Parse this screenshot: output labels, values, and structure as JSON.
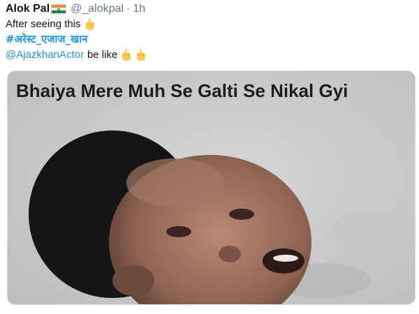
{
  "tweet": {
    "author_name": "Alok Pal",
    "handle": "@_alokpal",
    "separator": "·",
    "time": "1h",
    "line1_text": "After seeing this",
    "hashtag": "#अरेस्ट_एजाज_खान",
    "mention": "@AjazkhanActor",
    "line3_text": "be like",
    "media": {
      "caption": "Bhaiya Mere Muh Se Galti Se Nikal Gyi"
    }
  },
  "icons": {
    "flag": "india-flag-icon",
    "pointing_down": "pointing-down-hand-icon"
  },
  "colors": {
    "link": "#1b95e0",
    "secondary_text": "#657786",
    "primary_text": "#14171a"
  }
}
